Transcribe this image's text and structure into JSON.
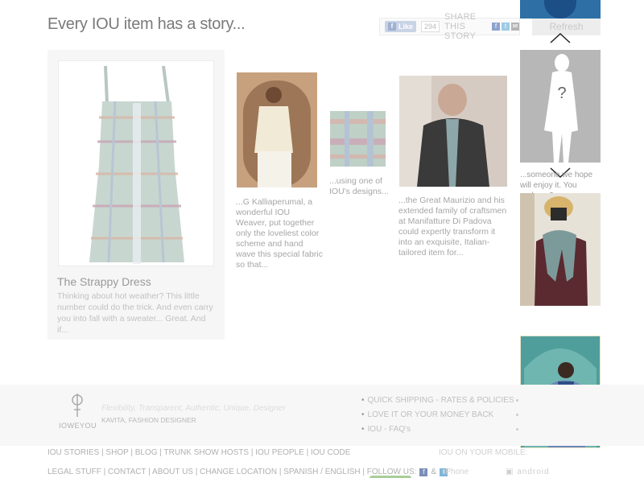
{
  "header": {
    "title": "Every IOU item has a story...",
    "like_label": "Like",
    "like_count": "294",
    "share_label": "SHARE THIS STORY",
    "refresh_label": "Refresh"
  },
  "feature": {
    "title": "The Strappy Dress",
    "description": "Thinking about hot weather? This little number could do the trick. And even carry you into fall with a sweater... Great. And if..."
  },
  "story": {
    "caption_1": "...G Kalliaperumal, a wonderful IOU Weaver, put together only the loveliest color scheme and hand wave this special fabric so that...",
    "caption_2": "...using one of IOU's designs...",
    "caption_3": "...the Great Maurizio and his extended family of craftsmen at Manifatture Di Padova could expertly transform it into an exquisite, Italian-tailored item for..."
  },
  "sidebar": {
    "mystery_caption": "...someone we hope will enjoy it. You perhaps?"
  },
  "footer": {
    "logo_text": "IOWEYOU",
    "tagline": "Flexibility, Transparent, Authentic, Unique, Designer",
    "tagline_author": "KAVITA, FASHION DESIGNER",
    "links": [
      "QUICK SHIPPING - RATES & POLICIES",
      "LOVE IT OR YOUR MONEY BACK",
      "IOU - FAQ's"
    ],
    "nav_1": "IOU STORIES | SHOP | BLOG | TRUNK SHOW HOSTS | IOU PEOPLE | IOU CODE",
    "nav_2": "LEGAL STUFF | CONTACT | ABOUT US | CHANGE LOCATION | SPANISH / ENGLISH | FOLLOW US:",
    "follow_amp": "&",
    "mobile_label": "IOU ON YOUR MOBILE:",
    "iphone_label": "iPhone",
    "android_label": "android"
  },
  "colors": {
    "accent_fb": "#7c8fb8",
    "accent_tw": "#7fb7d9",
    "mystery_bg": "#b7b7b7"
  }
}
